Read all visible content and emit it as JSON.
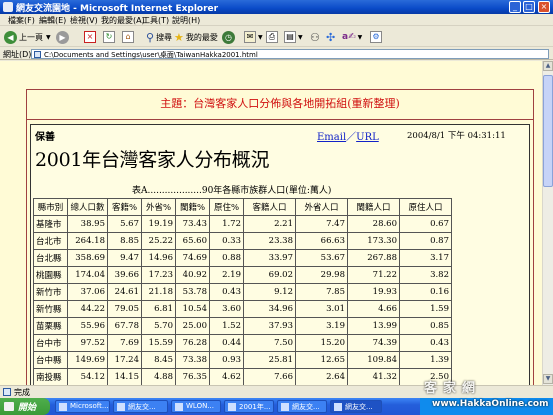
{
  "window": {
    "title": "網友交流園地 - Microsoft Internet Explorer"
  },
  "menu": [
    "檔案(F)",
    "編輯(E)",
    "檢視(V)",
    "我的最愛(A)",
    "工具(T)",
    "說明(H)"
  ],
  "toolbar": {
    "back": "上一頁",
    "search": "搜尋",
    "favorites": "我的最愛"
  },
  "address": {
    "label": "網址(D)",
    "url": "C:\\Documents and Settings\\user\\桌面\\TaiwanHakka2001.html"
  },
  "page": {
    "header": "主題：台灣客家人口分佈與各地開拓組(重新整理)",
    "author": "保善",
    "email_link": "Email",
    "sep": "／",
    "url_link": "URL",
    "timestamp": "2004/8/1 下午 04:31:11",
    "title": "2001年台灣客家人分布概況",
    "caption": "表A...................90年各縣市族群人口(單位:萬人)"
  },
  "table": {
    "headers": [
      "縣市別",
      "總人口數",
      "客籍%",
      "外省%",
      "閩籍%",
      "原住%",
      "客籍人口",
      "外省人口",
      "閩籍人口",
      "原住人口"
    ],
    "rows": [
      [
        "基隆市",
        "38.95",
        "5.67",
        "19.19",
        "73.43",
        "1.72",
        "2.21",
        "7.47",
        "28.60",
        "0.67"
      ],
      [
        "台北市",
        "264.18",
        "8.85",
        "25.22",
        "65.60",
        "0.33",
        "23.38",
        "66.63",
        "173.30",
        "0.87"
      ],
      [
        "台北縣",
        "358.69",
        "9.47",
        "14.96",
        "74.69",
        "0.88",
        "33.97",
        "53.67",
        "267.88",
        "3.17"
      ],
      [
        "桃園縣",
        "174.04",
        "39.66",
        "17.23",
        "40.92",
        "2.19",
        "69.02",
        "29.98",
        "71.22",
        "3.82"
      ],
      [
        "新竹市",
        "37.06",
        "24.61",
        "21.18",
        "53.78",
        "0.43",
        "9.12",
        "7.85",
        "19.93",
        "0.16"
      ],
      [
        "新竹縣",
        "44.22",
        "79.05",
        "6.81",
        "10.54",
        "3.60",
        "34.96",
        "3.01",
        "4.66",
        "1.59"
      ],
      [
        "苗栗縣",
        "55.96",
        "67.78",
        "5.70",
        "25.00",
        "1.52",
        "37.93",
        "3.19",
        "13.99",
        "0.85"
      ],
      [
        "台中市",
        "97.52",
        "7.69",
        "15.59",
        "76.28",
        "0.44",
        "7.50",
        "15.20",
        "74.39",
        "0.43"
      ],
      [
        "台中縣",
        "149.69",
        "17.24",
        "8.45",
        "73.38",
        "0.93",
        "25.81",
        "12.65",
        "109.84",
        "1.39"
      ],
      [
        "南投縣",
        "54.12",
        "14.15",
        "4.88",
        "76.35",
        "4.62",
        "7.66",
        "2.64",
        "41.32",
        "2.50"
      ]
    ]
  },
  "status": {
    "text": "完成"
  },
  "taskbar": {
    "start": "開始",
    "tasks": [
      "Microsoft...",
      "網友交...",
      "WLON...",
      "2001年...",
      "網友交...",
      "網友交..."
    ]
  },
  "watermark": {
    "url": "www.HakkaOnline.com",
    "logo": "客家網"
  }
}
